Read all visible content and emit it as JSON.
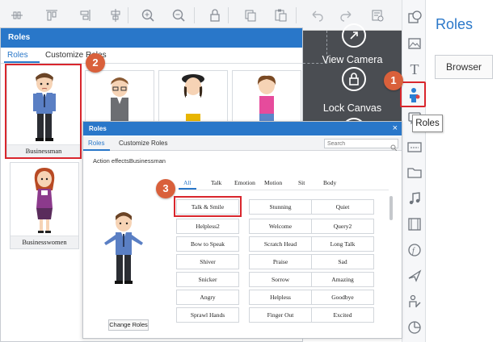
{
  "toolbar": {
    "icons": [
      "align-left-icon",
      "align-top-icon",
      "align-right-icon",
      "align-center-icon",
      "zoom-in-icon",
      "zoom-out-icon",
      "lock-icon",
      "copy-icon",
      "paste-icon",
      "undo-icon",
      "redo-icon",
      "preview-icon"
    ]
  },
  "canvas": {
    "view_camera": "View Camera",
    "lock_canvas": "Lock Canvas"
  },
  "right_panel": {
    "title": "Roles",
    "browser_button": "Browser"
  },
  "tooltip": "Roles",
  "badges": [
    "1",
    "2",
    "3"
  ],
  "roles_dialog": {
    "title": "Roles",
    "tabs": [
      "Roles",
      "Customize Roles"
    ],
    "cards": [
      {
        "label": "Businessman"
      },
      {
        "label": ""
      },
      {
        "label": ""
      },
      {
        "label": ""
      },
      {
        "label": "Businesswomen"
      }
    ]
  },
  "action_dialog": {
    "title": "Roles",
    "close": "×",
    "tabs": [
      "Roles",
      "Customize Roles"
    ],
    "search_placeholder": "Search",
    "action_label": "Action effectsBusinessman",
    "categories": [
      "All",
      "Talk",
      "Emotion",
      "Motion",
      "Sit",
      "Body"
    ],
    "actions": [
      "Talk & Smile",
      "Stunning",
      "Quiet",
      "Helpless2",
      "Welcome",
      "Query2",
      "Bow to Speak",
      "Scratch Head",
      "Long Talk",
      "Shiver",
      "Praise",
      "Sad",
      "Snicker",
      "Sorrow",
      "Amazing",
      "Angry",
      "Helpless",
      "Goodbye",
      "Sprawl Hands",
      "Finger Out",
      "Excited"
    ],
    "change_roles": "Change Roles"
  },
  "colors": {
    "accent": "#2977c9",
    "highlight": "#d9262d",
    "badge": "#d9603b"
  }
}
